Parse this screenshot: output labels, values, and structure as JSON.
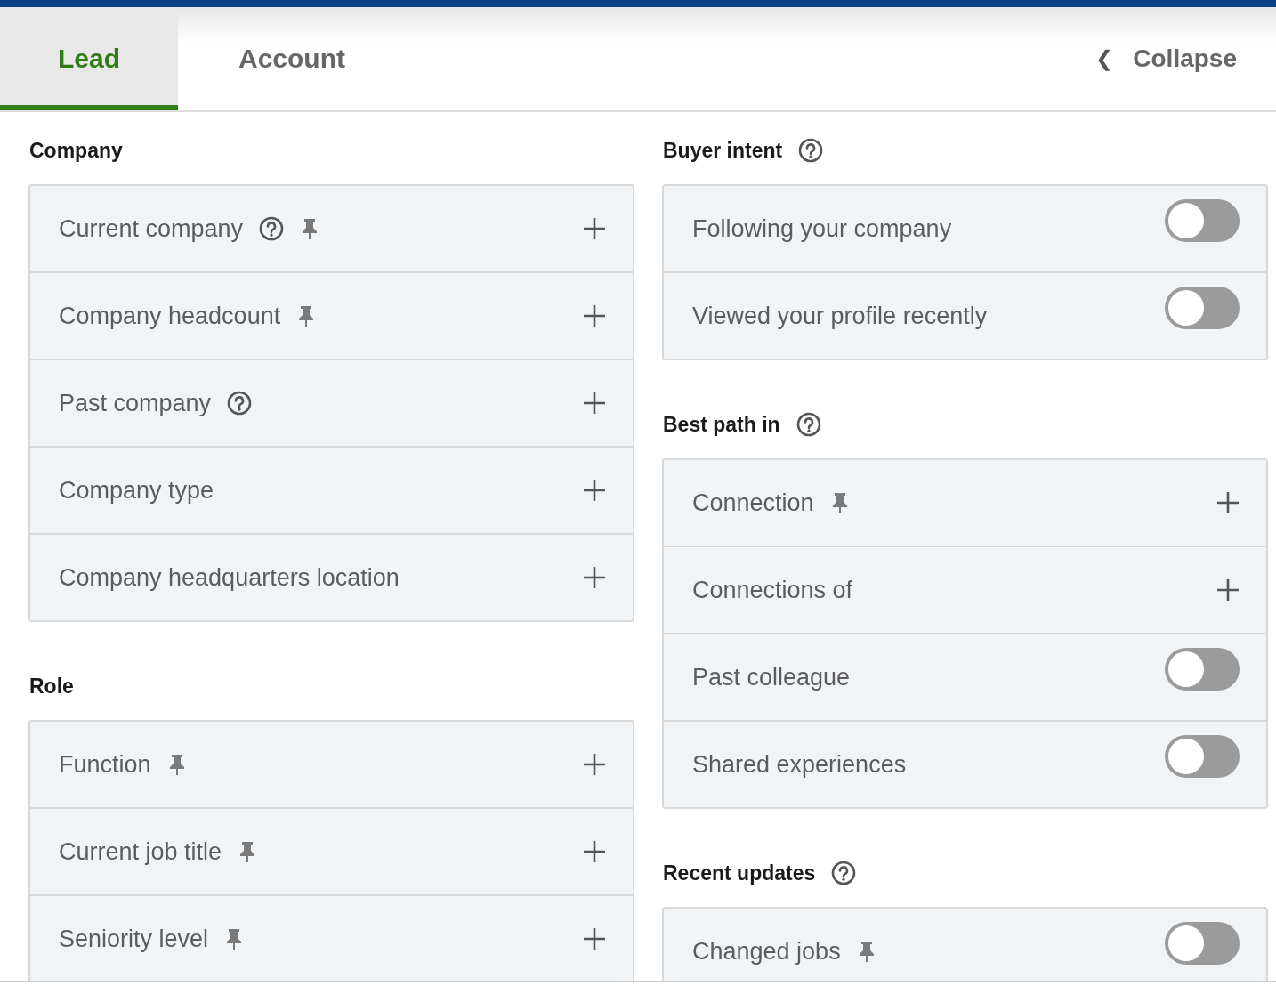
{
  "tabs": [
    {
      "label": "Lead",
      "selected": true
    },
    {
      "label": "Account",
      "selected": false
    }
  ],
  "collapse": {
    "icon": "❮",
    "label": "Collapse"
  },
  "columns": [
    [
      {
        "title": "Company",
        "help": false,
        "items": [
          {
            "label": "Current company",
            "kind": "expand",
            "help": true,
            "pinned": true
          },
          {
            "label": "Company headcount",
            "kind": "expand",
            "help": false,
            "pinned": true
          },
          {
            "label": "Past company",
            "kind": "expand",
            "help": true,
            "pinned": false
          },
          {
            "label": "Company type",
            "kind": "expand",
            "help": false,
            "pinned": false
          },
          {
            "label": "Company headquarters location",
            "kind": "expand",
            "help": false,
            "pinned": false
          }
        ]
      },
      {
        "title": "Role",
        "help": false,
        "items": [
          {
            "label": "Function",
            "kind": "expand",
            "help": false,
            "pinned": true
          },
          {
            "label": "Current job title",
            "kind": "expand",
            "help": false,
            "pinned": true
          },
          {
            "label": "Seniority level",
            "kind": "expand",
            "help": false,
            "pinned": true
          }
        ]
      }
    ],
    [
      {
        "title": "Buyer intent",
        "help": true,
        "items": [
          {
            "label": "Following your company",
            "kind": "toggle",
            "on": false,
            "help": false,
            "pinned": false
          },
          {
            "label": "Viewed your profile recently",
            "kind": "toggle",
            "on": false,
            "help": false,
            "pinned": false
          }
        ]
      },
      {
        "title": "Best path in",
        "help": true,
        "items": [
          {
            "label": "Connection",
            "kind": "expand",
            "help": false,
            "pinned": true
          },
          {
            "label": "Connections of",
            "kind": "expand",
            "help": false,
            "pinned": false
          },
          {
            "label": "Past colleague",
            "kind": "toggle",
            "on": false,
            "help": false,
            "pinned": false
          },
          {
            "label": "Shared experiences",
            "kind": "toggle",
            "on": false,
            "help": false,
            "pinned": false
          }
        ]
      },
      {
        "title": "Recent updates",
        "help": true,
        "items": [
          {
            "label": "Changed jobs",
            "kind": "toggle",
            "on": false,
            "help": false,
            "pinned": true
          }
        ]
      }
    ]
  ]
}
